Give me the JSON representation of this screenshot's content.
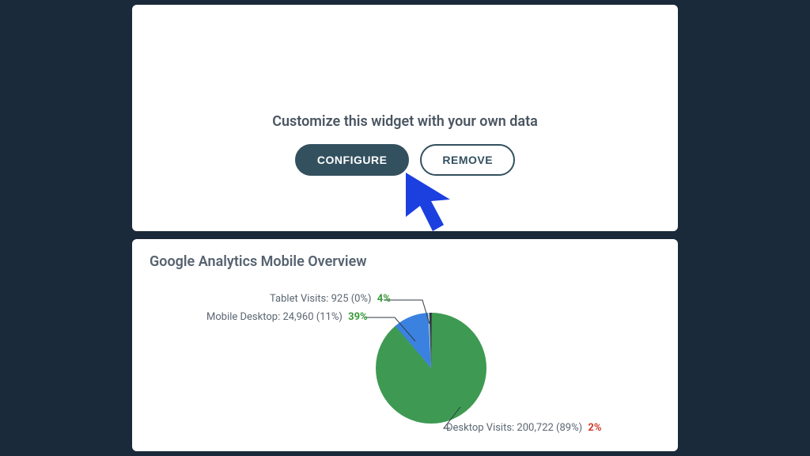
{
  "top": {
    "message": "Customize this widget with your own data",
    "configure_label": "CONFIGURE",
    "remove_label": "REMOVE"
  },
  "bottom": {
    "title": "Google Analytics Mobile Overview"
  },
  "chart_data": {
    "type": "pie",
    "title": "Google Analytics Mobile Overview",
    "series": [
      {
        "name": "Desktop Visits",
        "value": 200722,
        "share_percent": 89,
        "change_percent": 2,
        "change_dir": "down",
        "color": "#3e9a52"
      },
      {
        "name": "Mobile Desktop",
        "value": 24960,
        "share_percent": 11,
        "change_percent": 39,
        "change_dir": "up",
        "color": "#3b82e0"
      },
      {
        "name": "Tablet Visits",
        "value": 925,
        "share_percent": 0,
        "change_percent": 4,
        "change_dir": "up",
        "color": "#2f3a44"
      }
    ],
    "labels": {
      "tablet": {
        "text": "Tablet Visits: 925 (0%)",
        "pct": "4%"
      },
      "mobile": {
        "text": "Mobile Desktop: 24,960 (11%)",
        "pct": "39%"
      },
      "desktop": {
        "text": "Desktop Visits: 200,722 (89%)",
        "pct": "2%"
      }
    }
  },
  "colors": {
    "page_bg": "#1a2a3a",
    "card_bg": "#ffffff",
    "btn_dark": "#33505f",
    "cursor": "#1c3fe0"
  }
}
